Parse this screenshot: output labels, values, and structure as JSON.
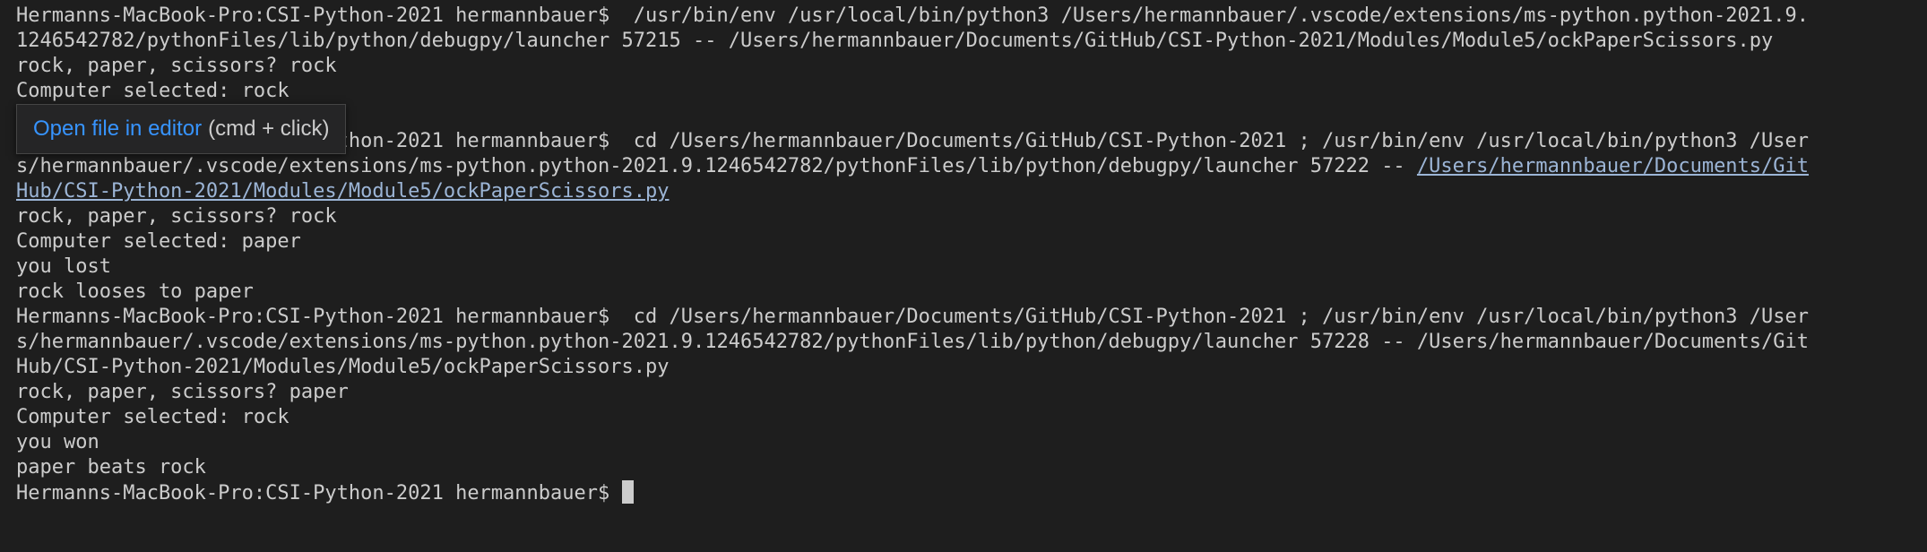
{
  "terminal": {
    "lines": [
      {
        "text": "Hermanns-MacBook-Pro:CSI-Python-2021 hermannbauer$  /usr/bin/env /usr/local/bin/python3 /Users/hermannbauer/.vscode/extensions/ms-python.python-2021.9."
      },
      {
        "text": "1246542782/pythonFiles/lib/python/debugpy/launcher 57215 -- /Users/hermannbauer/Documents/GitHub/CSI-Python-2021/Modules/Module5/ockPaperScissors.py"
      },
      {
        "text": "rock, paper, scissors? rock"
      },
      {
        "text": "Computer selected: rock"
      },
      {
        "text": ""
      },
      {
        "text": "Hermanns-MacBook-Pro:CSI-Python-2021 hermannbauer$  cd /Users/hermannbauer/Documents/GitHub/CSI-Python-2021 ; /usr/bin/env /usr/local/bin/python3 /User"
      },
      {
        "text": "s/hermannbauer/.vscode/extensions/ms-python.python-2021.9.1246542782/pythonFiles/lib/python/debugpy/launcher 57222 -- ",
        "link": "/Users/hermannbauer/Documents/Git"
      },
      {
        "text": "",
        "link": "Hub/CSI-Python-2021/Modules/Module5/ockPaperScissors.py"
      },
      {
        "text": "rock, paper, scissors? rock"
      },
      {
        "text": "Computer selected: paper"
      },
      {
        "text": "you lost"
      },
      {
        "text": "rock looses to paper"
      },
      {
        "text": "Hermanns-MacBook-Pro:CSI-Python-2021 hermannbauer$  cd /Users/hermannbauer/Documents/GitHub/CSI-Python-2021 ; /usr/bin/env /usr/local/bin/python3 /User"
      },
      {
        "text": "s/hermannbauer/.vscode/extensions/ms-python.python-2021.9.1246542782/pythonFiles/lib/python/debugpy/launcher 57228 -- /Users/hermannbauer/Documents/Git"
      },
      {
        "text": "Hub/CSI-Python-2021/Modules/Module5/ockPaperScissors.py"
      },
      {
        "text": "rock, paper, scissors? paper"
      },
      {
        "text": "Computer selected: rock"
      },
      {
        "text": "you won"
      },
      {
        "text": "paper beats rock"
      }
    ],
    "prompt": "Hermanns-MacBook-Pro:CSI-Python-2021 hermannbauer$ "
  },
  "tooltip": {
    "link_text": "Open file in editor",
    "hint_text": "(cmd + click)"
  },
  "colors": {
    "background": "#1e1e1e",
    "text": "#cccccc",
    "link": "#9cb5d6",
    "tooltip_link": "#3794ff"
  }
}
